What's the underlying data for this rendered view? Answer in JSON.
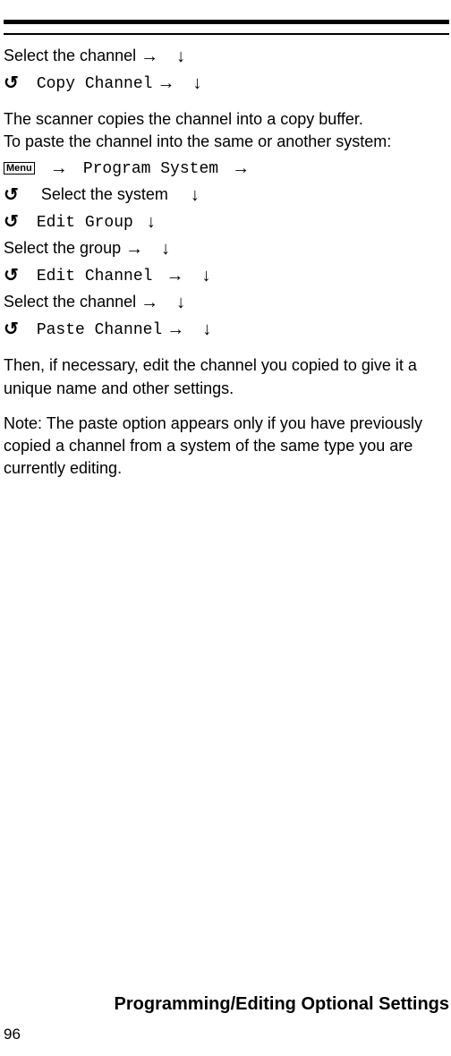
{
  "line1": {
    "pre": "Select the channel "
  },
  "line2": {
    "text": "Copy Channel"
  },
  "para1": {
    "a": "The scanner copies the channel into a copy buffer.",
    "b": "To paste the channel into the same or another system:"
  },
  "menuLabel": "Menu",
  "step1": {
    "text": "Program System"
  },
  "step2": {
    "pre": "Select the system"
  },
  "step3": {
    "text": "Edit Group"
  },
  "step4": {
    "pre": "Select the group "
  },
  "step5": {
    "text": "Edit Channel"
  },
  "step6": {
    "pre": "Select the channel "
  },
  "step7": {
    "text": "Paste Channel"
  },
  "para2": "Then, if necessary, edit the channel you copied to give it a  unique name and other settings.",
  "para3": "Note: The paste option appears only if you have previously copied a channel from a system of the same type you are currently editing.",
  "footer": "Programming/Editing Optional Settings",
  "pageNumber": "96"
}
